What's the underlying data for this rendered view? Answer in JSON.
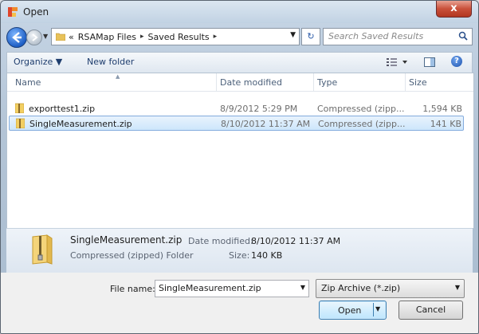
{
  "window": {
    "title": "Open",
    "close_glyph": "x"
  },
  "nav": {
    "recent_glyph": "▼",
    "breadcrumb": [
      "«",
      "RSAMap Files",
      "Saved Results"
    ],
    "separator": "▸",
    "dropdown_glyph": "▼",
    "refresh_glyph": "↻",
    "search_placeholder": "Search Saved Results"
  },
  "toolbar": {
    "organize": "Organize ▼",
    "new_folder": "New folder",
    "help_glyph": "?"
  },
  "columns": {
    "name": "Name",
    "date": "Date modified",
    "type": "Type",
    "size": "Size",
    "sort_glyph": "▲"
  },
  "files": [
    {
      "name": "exporttest1.zip",
      "date": "8/9/2012 5:29 PM",
      "type": "Compressed (zipp...",
      "size": "1,594 KB",
      "selected": false
    },
    {
      "name": "SingleMeasurement.zip",
      "date": "8/10/2012 11:37 AM",
      "type": "Compressed (zipp...",
      "size": "141 KB",
      "selected": true
    }
  ],
  "details": {
    "name": "SingleMeasurement.zip",
    "type": "Compressed (zipped) Folder",
    "date_label": "Date modified:",
    "date_value": "8/10/2012 11:37 AM",
    "size_label": "Size:",
    "size_value": "140 KB"
  },
  "bottom": {
    "filename_label": "File name:",
    "filename_value": "SingleMeasurement.zip",
    "filter_value": "Zip Archive (*.zip)",
    "open_label": "Open",
    "cancel_label": "Cancel",
    "dd_glyph": "▼"
  },
  "colors": {
    "accent": "#1e5fc5",
    "selection": "#cde6fb",
    "close": "#c9503a"
  }
}
